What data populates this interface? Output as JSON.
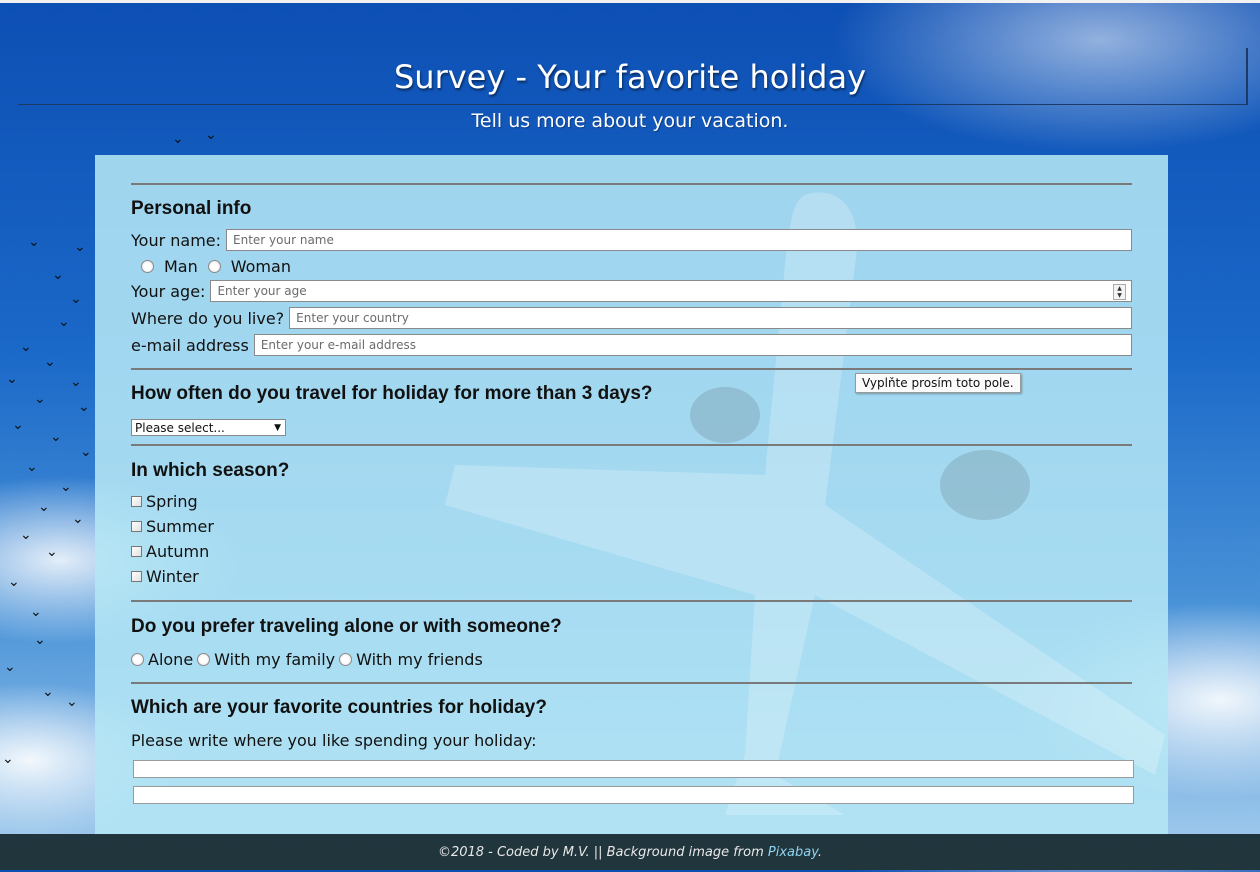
{
  "header": {
    "title": "Survey - Your favorite holiday",
    "subtitle": "Tell us more about your vacation."
  },
  "personal": {
    "heading": "Personal info",
    "name_label": "Your name:",
    "name_placeholder": "Enter your name",
    "gender_options": [
      "Man",
      "Woman"
    ],
    "age_label": "Your age:",
    "age_placeholder": "Enter your age",
    "country_label": "Where do you live?",
    "country_placeholder": "Enter your country",
    "email_label": "e-mail address",
    "email_placeholder": "Enter your e-mail address",
    "validation_tooltip": "Vyplňte prosím toto pole."
  },
  "frequency": {
    "heading": "How often do you travel for holiday for more than 3 days?",
    "select_value": "Please select..."
  },
  "season": {
    "heading": "In which season?",
    "options": [
      "Spring",
      "Summer",
      "Autumn",
      "Winter"
    ]
  },
  "company": {
    "heading": "Do you prefer traveling alone or with someone?",
    "options": [
      "Alone",
      "With my family",
      "With my friends"
    ]
  },
  "countries": {
    "heading": "Which are your favorite countries for holiday?",
    "prompt": "Please write where you like spending your holiday:"
  },
  "footer": {
    "text": "©2018 - Coded by M.V. || Background image from ",
    "link": "Pixabay",
    "end": "."
  }
}
